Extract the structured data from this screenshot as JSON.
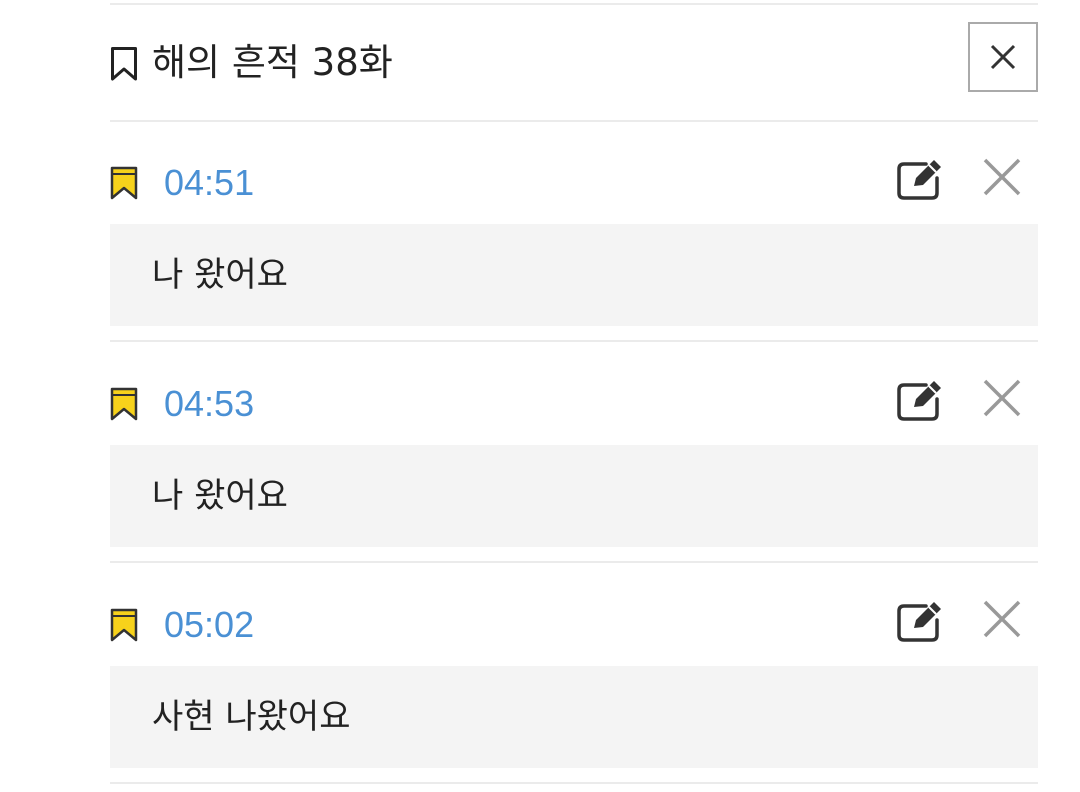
{
  "header": {
    "title": "해의 흔적 38화",
    "bookmark_icon": "bookmark-outline-icon",
    "close_icon": "close-icon"
  },
  "bookmarks": [
    {
      "time": "04:51",
      "note": "나 왔어요"
    },
    {
      "time": "04:53",
      "note": "나 왔어요"
    },
    {
      "time": "05:02",
      "note": "사현 나왔어요"
    }
  ],
  "icons": {
    "entry_bookmark": "bookmark-filled-icon",
    "edit": "edit-icon",
    "delete": "delete-icon"
  },
  "colors": {
    "time_text": "#4a90d4",
    "bookmark_fill": "#f7d21b",
    "note_background": "#f4f4f4",
    "divider": "#ebebeb"
  }
}
